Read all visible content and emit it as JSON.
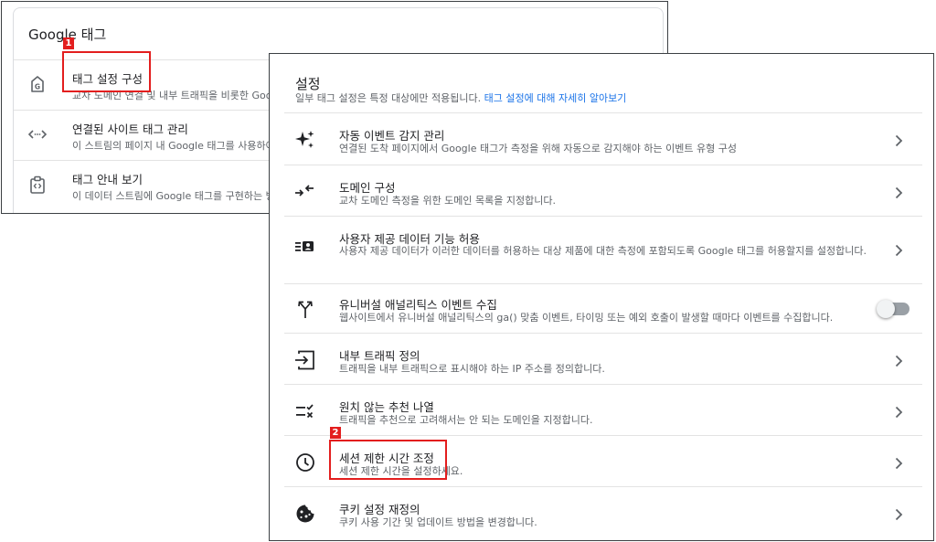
{
  "back_panel": {
    "title": "Google 태그",
    "items": [
      {
        "title": "태그 설정 구성",
        "desc": "교차 도메인 연결 및 내부 트래픽을 비롯한 Goo",
        "icon": "google-tag-icon"
      },
      {
        "title": "연결된 사이트 태그 관리",
        "desc": "이 스트림의 페이지 내 Google 태그를 사용하여",
        "icon": "code-arrows-icon"
      },
      {
        "title": "태그 안내 보기",
        "desc": "이 데이터 스트림에 Google 태그를 구현하는 방",
        "icon": "clipboard-code-icon"
      }
    ]
  },
  "settings": {
    "title": "설정",
    "subtitle": "일부 태그 설정은 특정 대상에만 적용됩니다.",
    "learn_more": "태그 설정에 대해 자세히 알아보기",
    "items": [
      {
        "title": "자동 이벤트 감지 관리",
        "desc": "연결된 도착 페이지에서 Google 태그가 측정을 위해 자동으로 감지해야 하는 이벤트 유형 구성",
        "icon": "sparkle-icon",
        "control": "chevron"
      },
      {
        "title": "도메인 구성",
        "desc": "교차 도메인 측정을 위한 도메인 목록을 지정합니다.",
        "icon": "merge-arrows-icon",
        "control": "chevron"
      },
      {
        "title": "사용자 제공 데이터 기능 허용",
        "desc": "사용자 제공 데이터가 이러한 데이터를 허용하는 대상 제품에 대한 측정에 포함되도록 Google 태그를 허용할지를 설정합니다.",
        "icon": "user-data-icon",
        "control": "chevron"
      },
      {
        "title": "유니버설 애널리틱스 이벤트 수집",
        "desc": "웹사이트에서 유니버설 애널리틱스의 ga() 맞춤 이벤트, 타이밍 또는 예외 호출이 발생할 때마다 이벤트를 수집합니다.",
        "icon": "split-arrows-icon",
        "control": "toggle",
        "enabled": false
      },
      {
        "title": "내부 트래픽 정의",
        "desc": "트래픽을 내부 트래픽으로 표시해야 하는 IP 주소를 정의합니다.",
        "icon": "login-icon",
        "control": "chevron"
      },
      {
        "title": "원치 않는 추천 나열",
        "desc": "트래픽을 추천으로 고려해서는 안 되는 도메인을 지정합니다.",
        "icon": "list-exclude-icon",
        "control": "chevron"
      },
      {
        "title": "세션 제한 시간 조정",
        "desc": "세션 제한 시간을 설정하세요.",
        "icon": "clock-icon",
        "control": "chevron"
      },
      {
        "title": "쿠키 설정 재정의",
        "desc": "쿠키 사용 기간 및 업데이트 방법을 변경합니다.",
        "icon": "cookie-icon",
        "control": "chevron"
      }
    ]
  },
  "annotations": {
    "badge_1": "1",
    "badge_2": "2",
    "highlight_color": "#e31e1e"
  },
  "colors": {
    "link": "#1a73e8",
    "text_primary": "#202124",
    "text_secondary": "#5f6368"
  }
}
